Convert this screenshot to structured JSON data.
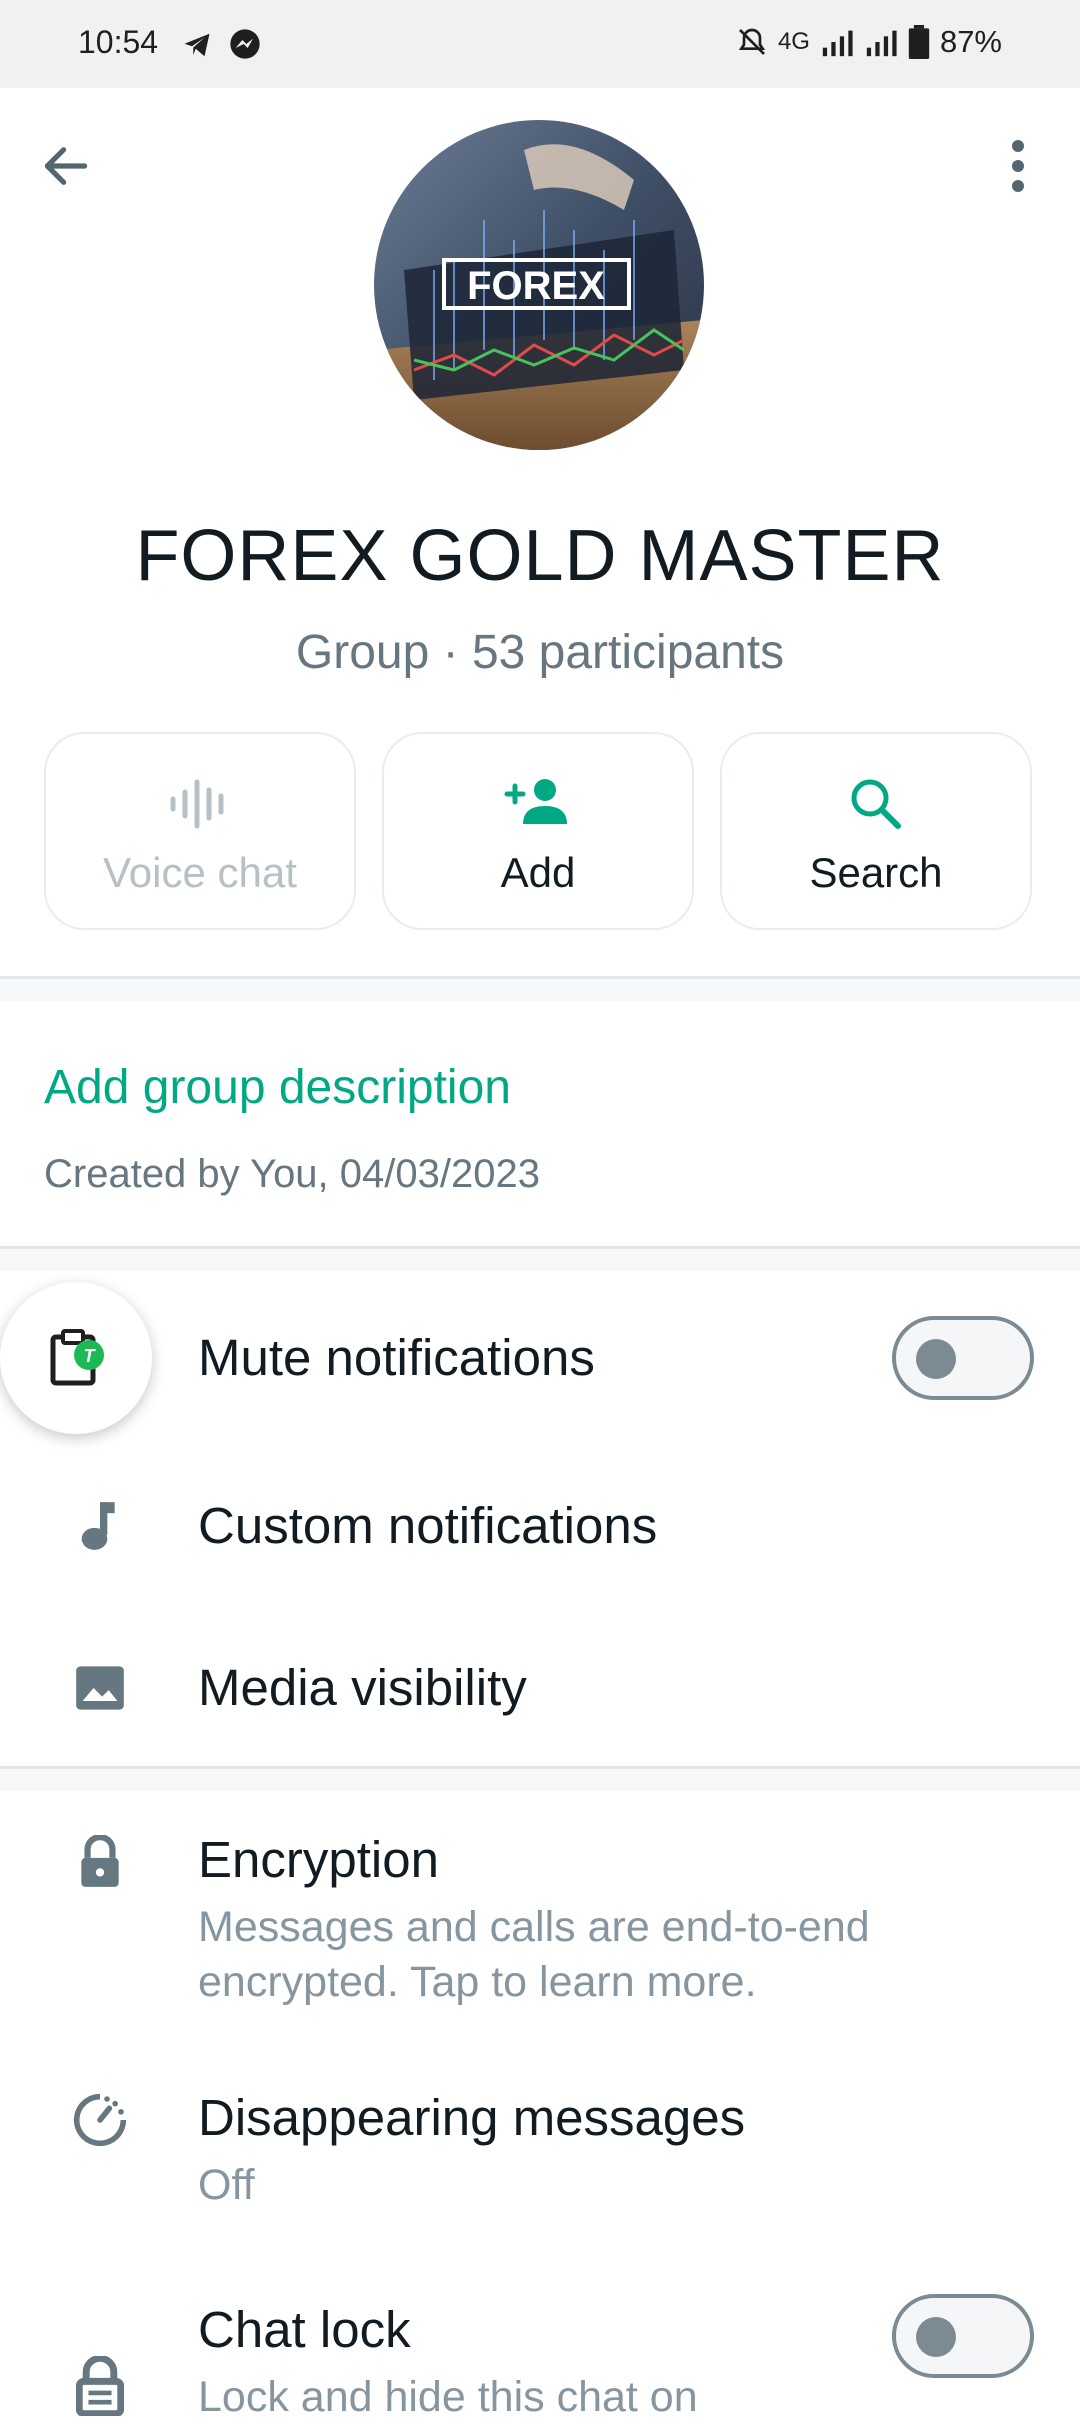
{
  "status_bar": {
    "time": "10:54",
    "network": "4G",
    "battery": "87%",
    "icons": [
      "telegram-icon",
      "messenger-icon",
      "mute-icon",
      "signal-icon",
      "signal-icon",
      "battery-icon"
    ]
  },
  "header": {
    "logo_text": "FOREX",
    "group_name": "FOREX GOLD MASTER",
    "subtitle": "Group · 53 participants"
  },
  "actions": [
    {
      "label": "Voice chat",
      "icon": "voice-wave-icon",
      "enabled": false
    },
    {
      "label": "Add",
      "icon": "add-person-icon",
      "enabled": true
    },
    {
      "label": "Search",
      "icon": "search-icon",
      "enabled": true
    }
  ],
  "description": {
    "link": "Add group description",
    "created": "Created by You, 04/03/2023"
  },
  "settings": {
    "mute": {
      "label": "Mute notifications",
      "toggle": "off"
    },
    "custom": {
      "label": "Custom notifications"
    },
    "media": {
      "label": "Media visibility"
    },
    "encryption": {
      "label": "Encryption",
      "sub": "Messages and calls are end-to-end encrypted. Tap to learn more."
    },
    "disappearing": {
      "label": "Disappearing messages",
      "sub": "Off"
    },
    "chatlock": {
      "label": "Chat lock",
      "sub": "Lock and hide this chat on",
      "toggle": "off"
    }
  },
  "floating": {
    "badge": "T"
  },
  "colors": {
    "accent": "#00a884",
    "icon_gray": "#667781",
    "text": "#111b21"
  }
}
